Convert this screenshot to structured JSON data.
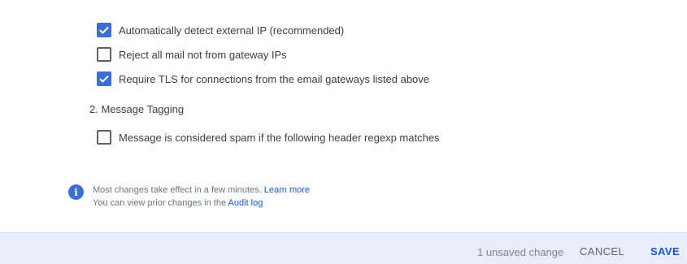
{
  "section1": {
    "options": [
      {
        "label": "Automatically detect external IP (recommended)",
        "checked": true
      },
      {
        "label": "Reject all mail not from gateway IPs",
        "checked": false
      },
      {
        "label": "Require TLS for connections from the email gateways listed above",
        "checked": true
      }
    ]
  },
  "section2": {
    "title": "2. Message Tagging",
    "options": [
      {
        "label": "Message is considered spam if the following header regexp matches",
        "checked": false
      }
    ]
  },
  "info": {
    "icon": "info-icon",
    "line1_text": "Most changes take effect in a few minutes.",
    "line1_link": "Learn more",
    "line2_text": "You can view prior changes in the",
    "line2_link": "Audit log"
  },
  "footer": {
    "status": "1 unsaved change",
    "cancel_label": "CANCEL",
    "save_label": "SAVE"
  },
  "colors": {
    "accent": "#3c6fd6",
    "link": "#1a57c2",
    "footer_bg": "#e8eef9"
  }
}
